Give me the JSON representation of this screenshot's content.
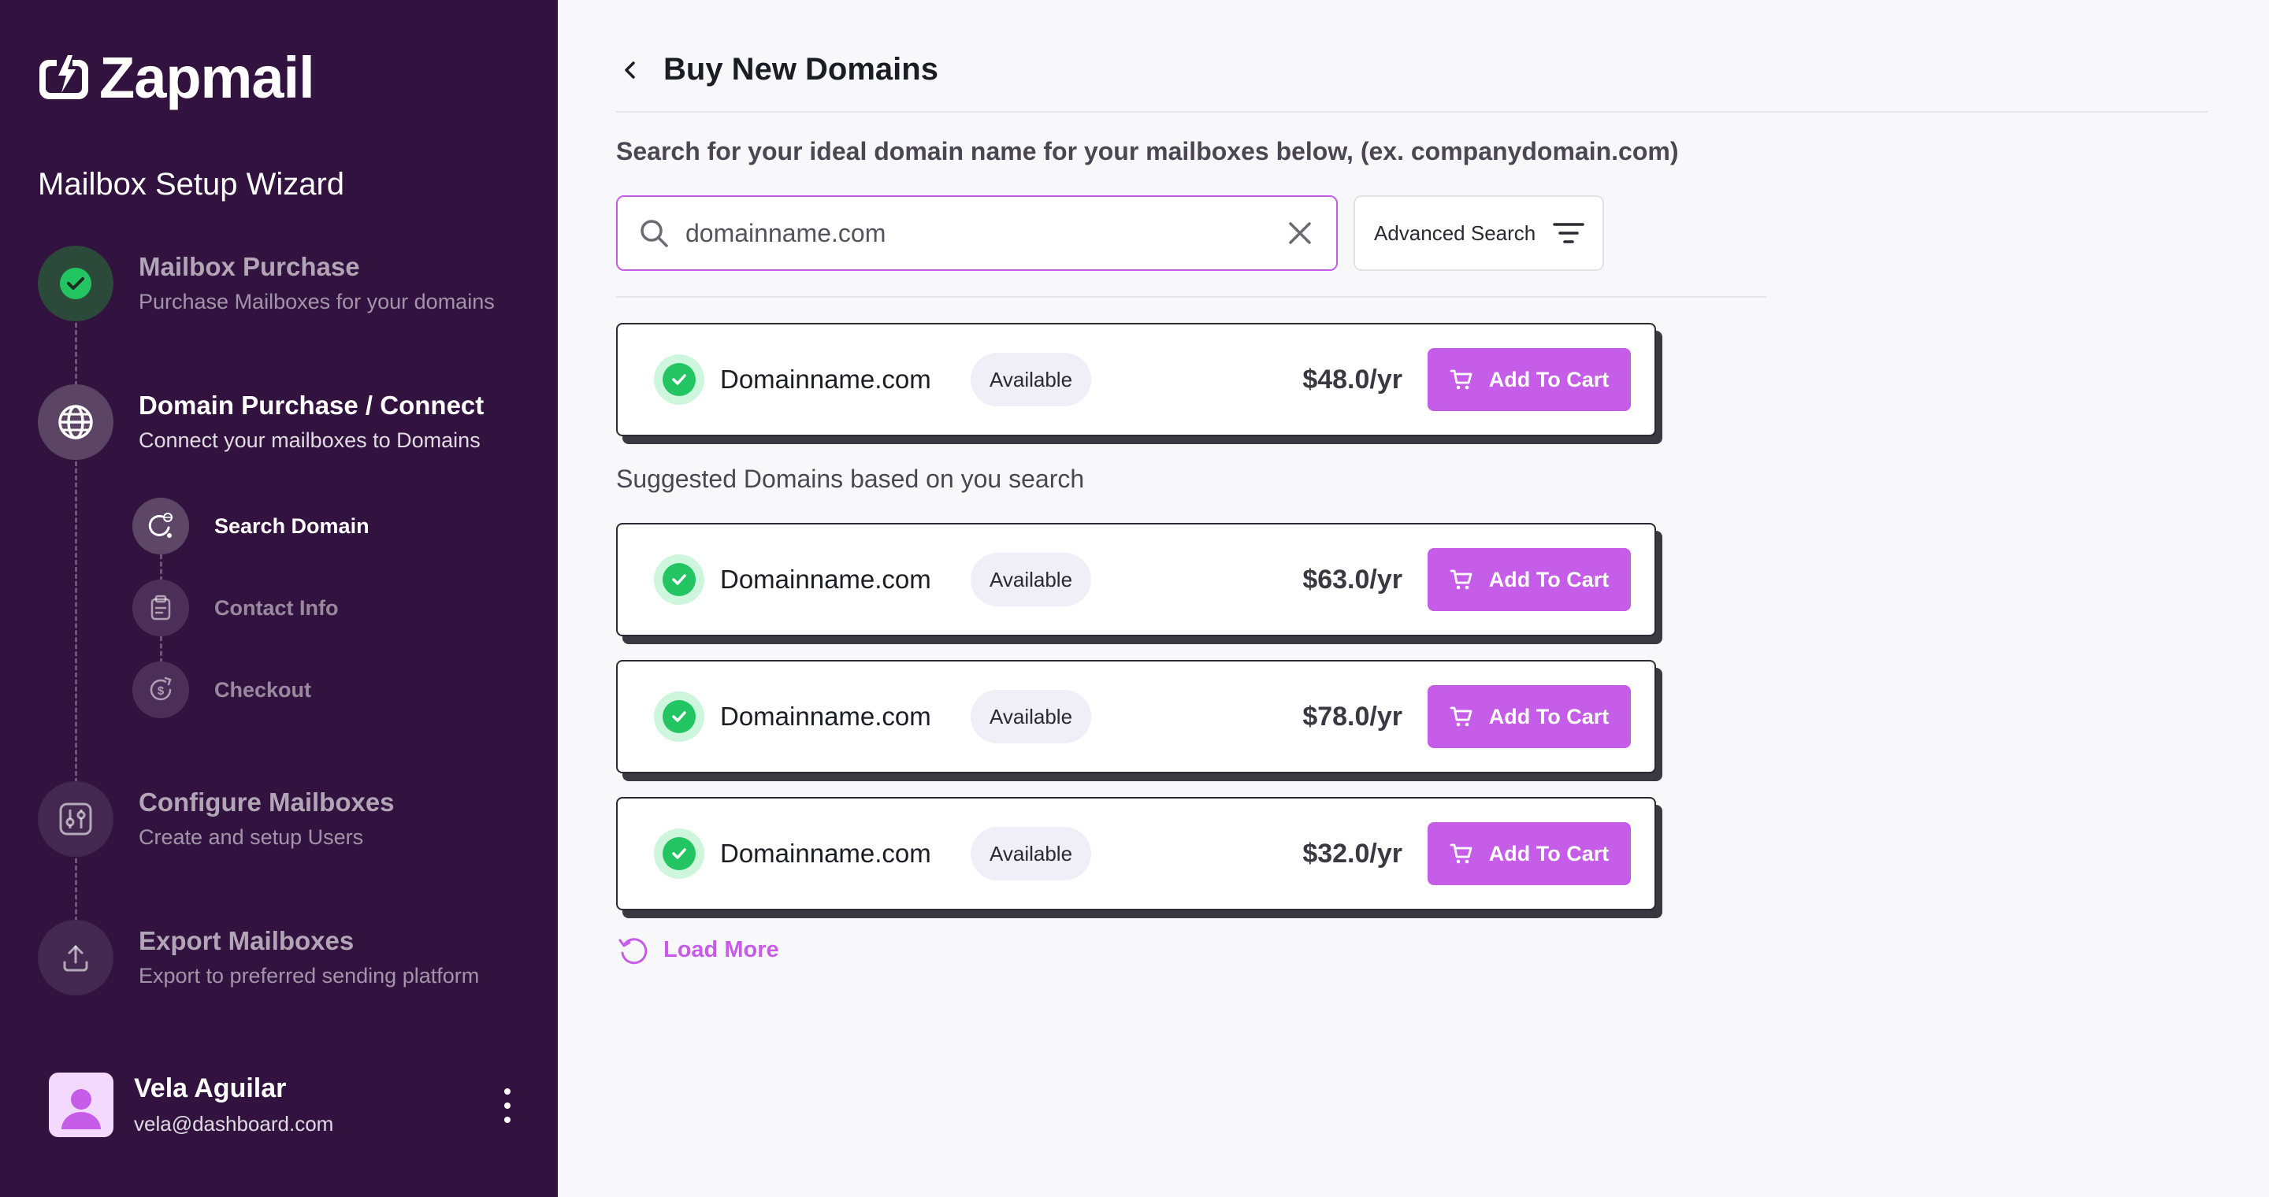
{
  "brand": {
    "name": "Zapmail"
  },
  "sidebar": {
    "wizard_title": "Mailbox Setup Wizard",
    "steps": [
      {
        "title": "Mailbox Purchase",
        "subtitle": "Purchase Mailboxes for your domains",
        "status": "done",
        "icon": "check-icon"
      },
      {
        "title": "Domain Purchase / Connect",
        "subtitle": "Connect your mailboxes to Domains",
        "status": "active",
        "icon": "globe-icon",
        "substeps": [
          {
            "label": "Search Domain",
            "status": "active",
            "icon": "search-globe-icon"
          },
          {
            "label": "Contact Info",
            "status": "pending",
            "icon": "clipboard-icon"
          },
          {
            "label": "Checkout",
            "status": "pending",
            "icon": "dollar-refresh-icon"
          }
        ]
      },
      {
        "title": "Configure Mailboxes",
        "subtitle": "Create and setup Users",
        "status": "pending",
        "icon": "sliders-icon"
      },
      {
        "title": "Export Mailboxes",
        "subtitle": "Export to preferred sending platform",
        "status": "pending",
        "icon": "upload-icon"
      }
    ],
    "user": {
      "name": "Vela Aguilar",
      "email": "vela@dashboard.com"
    }
  },
  "main": {
    "title": "Buy New Domains",
    "instruction": "Search for your ideal domain name for your mailboxes below, (ex. companydomain.com)",
    "search": {
      "value": "domainname.com",
      "placeholder": ""
    },
    "advanced_search_label": "Advanced Search",
    "primary_result": {
      "domain": "Domainname.com",
      "status": "Available",
      "price": "$48.0/yr",
      "cta": "Add To Cart"
    },
    "suggested_title": "Suggested Domains based on you search",
    "suggested": [
      {
        "domain": "Domainname.com",
        "status": "Available",
        "price": "$63.0/yr",
        "cta": "Add To Cart"
      },
      {
        "domain": "Domainname.com",
        "status": "Available",
        "price": "$78.0/yr",
        "cta": "Add To Cart"
      },
      {
        "domain": "Domainname.com",
        "status": "Available",
        "price": "$32.0/yr",
        "cta": "Add To Cart"
      }
    ],
    "load_more_label": "Load More"
  },
  "colors": {
    "sidebar_bg": "#32133f",
    "accent": "#c65de8",
    "success": "#23c462",
    "page_bg": "#f8f8fa"
  }
}
